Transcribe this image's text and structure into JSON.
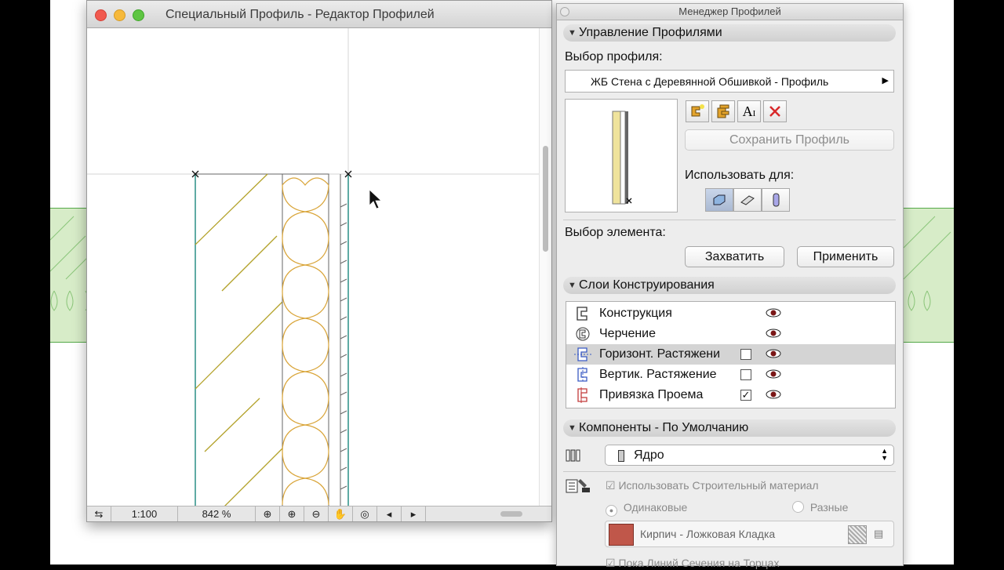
{
  "editor": {
    "title": "Специальный Профиль - Редактор Профилей",
    "status": {
      "scale": "1:100",
      "zoom": "842 %"
    }
  },
  "manager": {
    "title": "Менеджер Профилей",
    "sections": {
      "profiles": "Управление Профилями",
      "layers": "Слои Конструирования",
      "components": "Компоненты - По Умолчанию"
    },
    "profile_select_label": "Выбор профиля:",
    "profile_name": "ЖБ Стена с Деревянной Обшивкой - Профиль",
    "save_button": "Сохранить Профиль",
    "use_for_label": "Использовать для:",
    "element_select_label": "Выбор элемента:",
    "capture_button": "Захватить",
    "apply_button": "Применить",
    "layers": [
      {
        "name": "Конструкция",
        "has_checkbox": false,
        "checked": false
      },
      {
        "name": "Черчение",
        "has_checkbox": false,
        "checked": false
      },
      {
        "name": "Горизонт. Растяжени",
        "has_checkbox": true,
        "checked": false
      },
      {
        "name": "Вертик. Растяжение",
        "has_checkbox": true,
        "checked": false
      },
      {
        "name": "Привязка Проема",
        "has_checkbox": true,
        "checked": true
      }
    ],
    "component_select": "Ядро",
    "use_material_label": "Использовать Строительный материал",
    "radio_same": "Одинаковые",
    "radio_different": "Разные",
    "material_name": "Кирпич - Ложковая Кладка",
    "bottom_cut_text": "Пока Линий Сечения на Торцах",
    "colors": {
      "material_swatch": "#c0574a",
      "selected_row": "#d4d4d4",
      "delete_icon": "#d8282a",
      "insulation": "#d9a53a",
      "hatch": "#b3a22a",
      "teal_line": "#2a8f86"
    }
  }
}
